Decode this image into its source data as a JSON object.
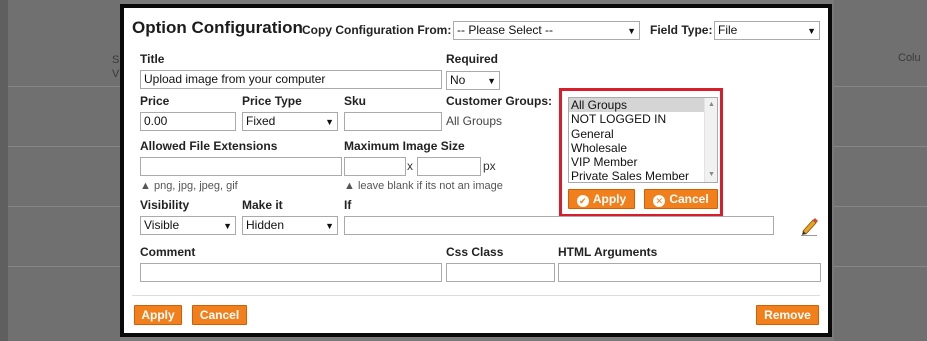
{
  "background": {
    "left_text": [
      "S",
      "V"
    ],
    "right_text": "Colu"
  },
  "dialog": {
    "title": "Option Configuration",
    "copy_from": {
      "label": "Copy Configuration From:",
      "value": "-- Please Select --"
    },
    "field_type": {
      "label": "Field Type:",
      "value": "File"
    }
  },
  "fields": {
    "title": {
      "label": "Title",
      "value": "Upload image from your computer"
    },
    "required": {
      "label": "Required",
      "value": "No"
    },
    "price": {
      "label": "Price",
      "value": "0.00"
    },
    "price_type": {
      "label": "Price Type",
      "value": "Fixed"
    },
    "sku": {
      "label": "Sku",
      "value": ""
    },
    "customer_groups": {
      "label": "Customer Groups:",
      "summary": "All Groups",
      "options": [
        "All Groups",
        "NOT LOGGED IN",
        "General",
        "Wholesale",
        "VIP Member",
        "Private Sales Member"
      ],
      "selected": "All Groups",
      "apply_label": "Apply",
      "cancel_label": "Cancel"
    },
    "allowed_ext": {
      "label": "Allowed File Extensions",
      "value": "",
      "hint": "png, jpg, jpeg, gif"
    },
    "max_image_size": {
      "label": "Maximum Image Size",
      "x": "x",
      "unit": "px",
      "hint": "leave blank if its not an image"
    },
    "visibility": {
      "label": "Visibility",
      "value": "Visible"
    },
    "make_it": {
      "label": "Make it",
      "value": "Hidden"
    },
    "if": {
      "label": "If",
      "value": ""
    },
    "comment": {
      "label": "Comment",
      "value": ""
    },
    "css_class": {
      "label": "Css Class",
      "value": ""
    },
    "html_args": {
      "label": "HTML Arguments",
      "value": ""
    }
  },
  "footer": {
    "apply_label": "Apply",
    "cancel_label": "Cancel",
    "remove_label": "Remove"
  },
  "colors": {
    "accent": "#f07f1c",
    "highlight_border": "#d81e2a"
  },
  "icons": {
    "dropdown": "chevron-down-icon",
    "apply": "check-circle-icon",
    "cancel": "close-circle-icon",
    "edit": "pencil-icon"
  }
}
